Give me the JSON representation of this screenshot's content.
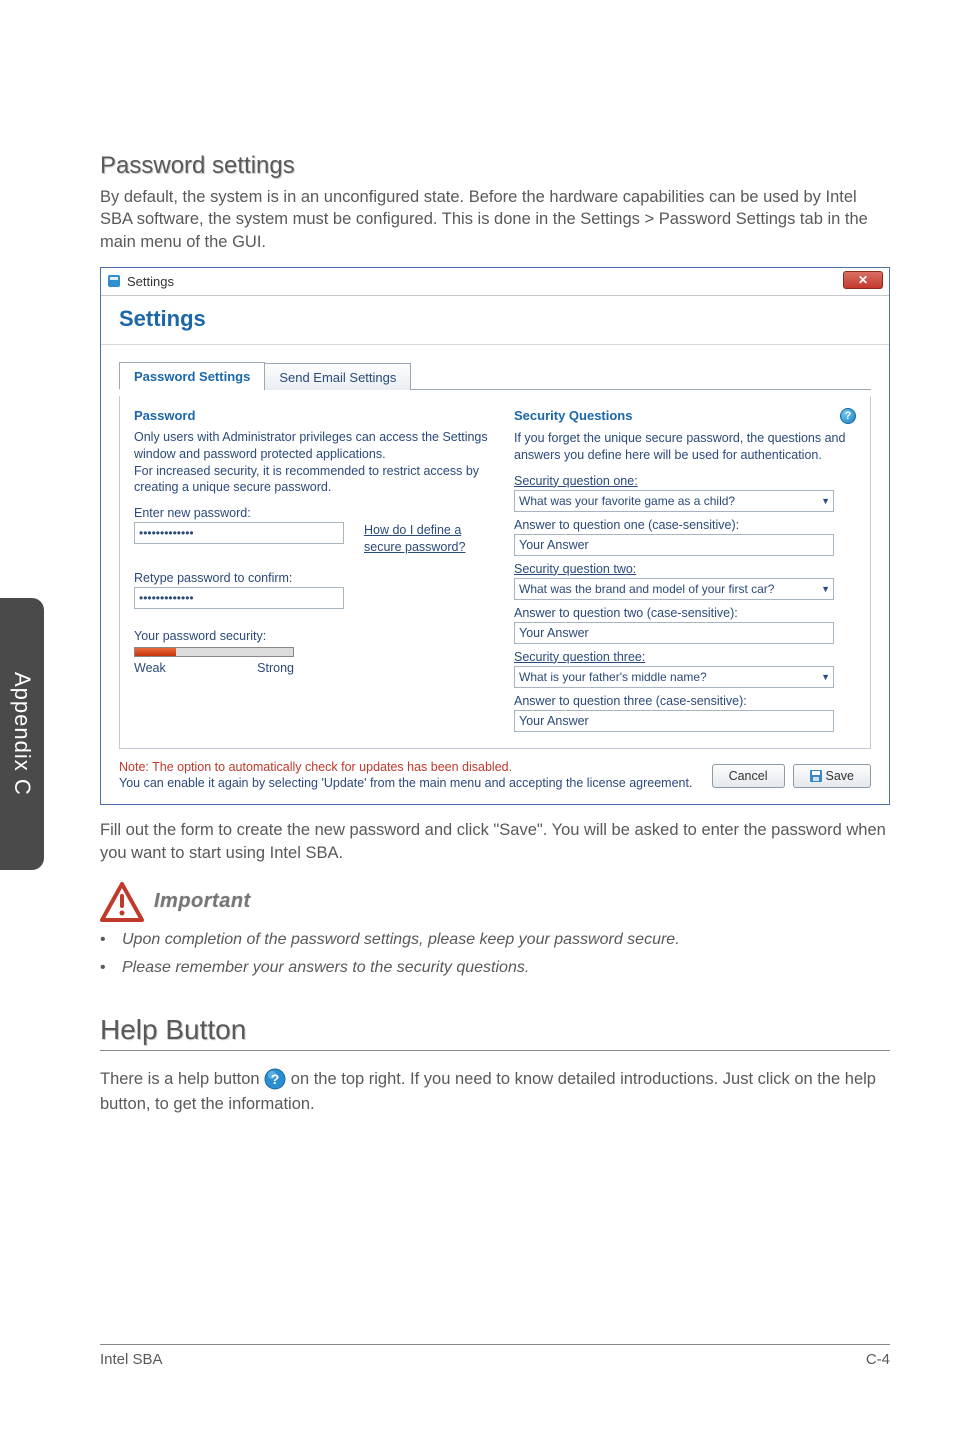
{
  "side_tab": "Appendix C",
  "heading_password": "Password settings",
  "intro_text": "By default, the system is in an unconfigured state. Before the hardware capabilities can be used by Intel SBA software, the system must be configured. This is done in the Settings > Password Settings tab in the main menu of the GUI.",
  "window": {
    "title": "Settings",
    "close_glyph": "✕"
  },
  "settings_header": "Settings",
  "tabs": {
    "password": "Password Settings",
    "email": "Send Email Settings"
  },
  "left": {
    "heading": "Password",
    "description": "Only users with Administrator privileges can access the Settings window and password protected applications.\nFor increased security, it is recommended to restrict access by creating a unique secure password.",
    "enter_label": "Enter new password:",
    "pw_value": "•••••••••••••",
    "how_link_line1": "How do I define a",
    "how_link_line2": "secure password?",
    "retype_label": "Retype password to confirm:",
    "retype_value": "•••••••••••••",
    "strength_label": "Your password security:",
    "weak": "Weak",
    "strong": "Strong"
  },
  "right": {
    "heading": "Security Questions",
    "description": "If you forget the unique secure password, the questions and answers you define here will be used for authentication.",
    "q1_label": "Security question one:",
    "q1_value": "What was your favorite game as a child?",
    "a1_label": "Answer to question one (case-sensitive):",
    "a1_value": "Your Answer",
    "q2_label": "Security question two:",
    "q2_value": "What was the brand and model of your first car?",
    "a2_label": "Answer to question two (case-sensitive):",
    "a2_value": "Your Answer",
    "q3_label": "Security question three:",
    "q3_value": "What is your father's middle name?",
    "a3_label": "Answer to question three (case-sensitive):",
    "a3_value": "Your Answer"
  },
  "note": {
    "red": "Note: The option to automatically check for updates has been disabled.",
    "blue": "You can enable it again by selecting 'Update' from the main menu and accepting the license agreement."
  },
  "buttons": {
    "cancel": "Cancel",
    "save": "Save"
  },
  "after_shot": "Fill out the form to create the new password and click \"Save\". You will be asked to enter the password when you want to start using Intel SBA.",
  "important_label": "Important",
  "bullets": {
    "b1": "Upon completion of the password settings, please keep your password secure.",
    "b2": "Please remember your answers to the security questions."
  },
  "heading_help": "Help Button",
  "help_para_1": "There is a help button ",
  "help_para_2": " on the top right. If you need to know detailed introductions. Just click on the help button, to get the information.",
  "footer": {
    "left": "Intel SBA",
    "right": "C-4"
  }
}
